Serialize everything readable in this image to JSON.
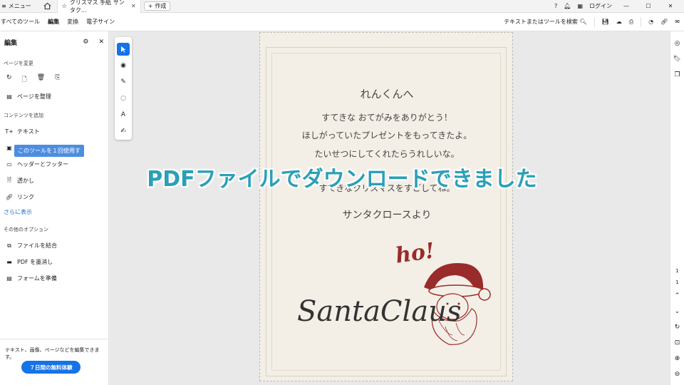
{
  "titlebar": {
    "menu_label": "メニュー",
    "tab_title": "クリスマス 手紙 サンタク...",
    "new_tab_label": "作成",
    "login_label": "ログイン"
  },
  "toolbar": {
    "tabs": [
      "すべてのツール",
      "編集",
      "変換",
      "電子サイン"
    ],
    "active_tab": "編集",
    "search_label": "テキストまたはツールを検索"
  },
  "left_panel": {
    "title": "編集",
    "section_pages": "ページを変更",
    "organize_pages": "ページを整理",
    "section_content": "コンテンツを追加",
    "items": [
      {
        "label": "テキスト",
        "icon": "text-add-icon"
      },
      {
        "label": "画像",
        "icon": "image-icon"
      },
      {
        "label": "ヘッダーとフッター",
        "icon": "header-footer-icon"
      },
      {
        "label": "透かし",
        "icon": "watermark-icon"
      },
      {
        "label": "リンク",
        "icon": "link-icon"
      }
    ],
    "tooltip": "このツールを１回使用す",
    "show_more": "さらに表示",
    "section_other": "その他のオプション",
    "other_items": [
      {
        "label": "ファイルを結合",
        "icon": "combine-files-icon"
      },
      {
        "label": "PDF を墨消し",
        "icon": "redact-icon"
      },
      {
        "label": "フォームを準備",
        "icon": "form-icon"
      }
    ],
    "footer_text": "テキスト、画像、ページなどを編集できます。",
    "trial_button": "７日間の無料体験"
  },
  "document": {
    "to": "れんくんへ",
    "lines": [
      "すてきな おてがみをありがとう！",
      "ほしがっていたプレゼントをもってきたよ。",
      "たいせつにしてくれたらうれしいな。",
      "すてきなクリスマスをすごしてね。"
    ],
    "from": "サンタクロースより",
    "hoho": "ho!",
    "signature": "SantaClaus"
  },
  "overlay_banner": "PDFファイルでダウンロードできました",
  "right_rail": {
    "page_current": "1",
    "page_total": "1"
  }
}
